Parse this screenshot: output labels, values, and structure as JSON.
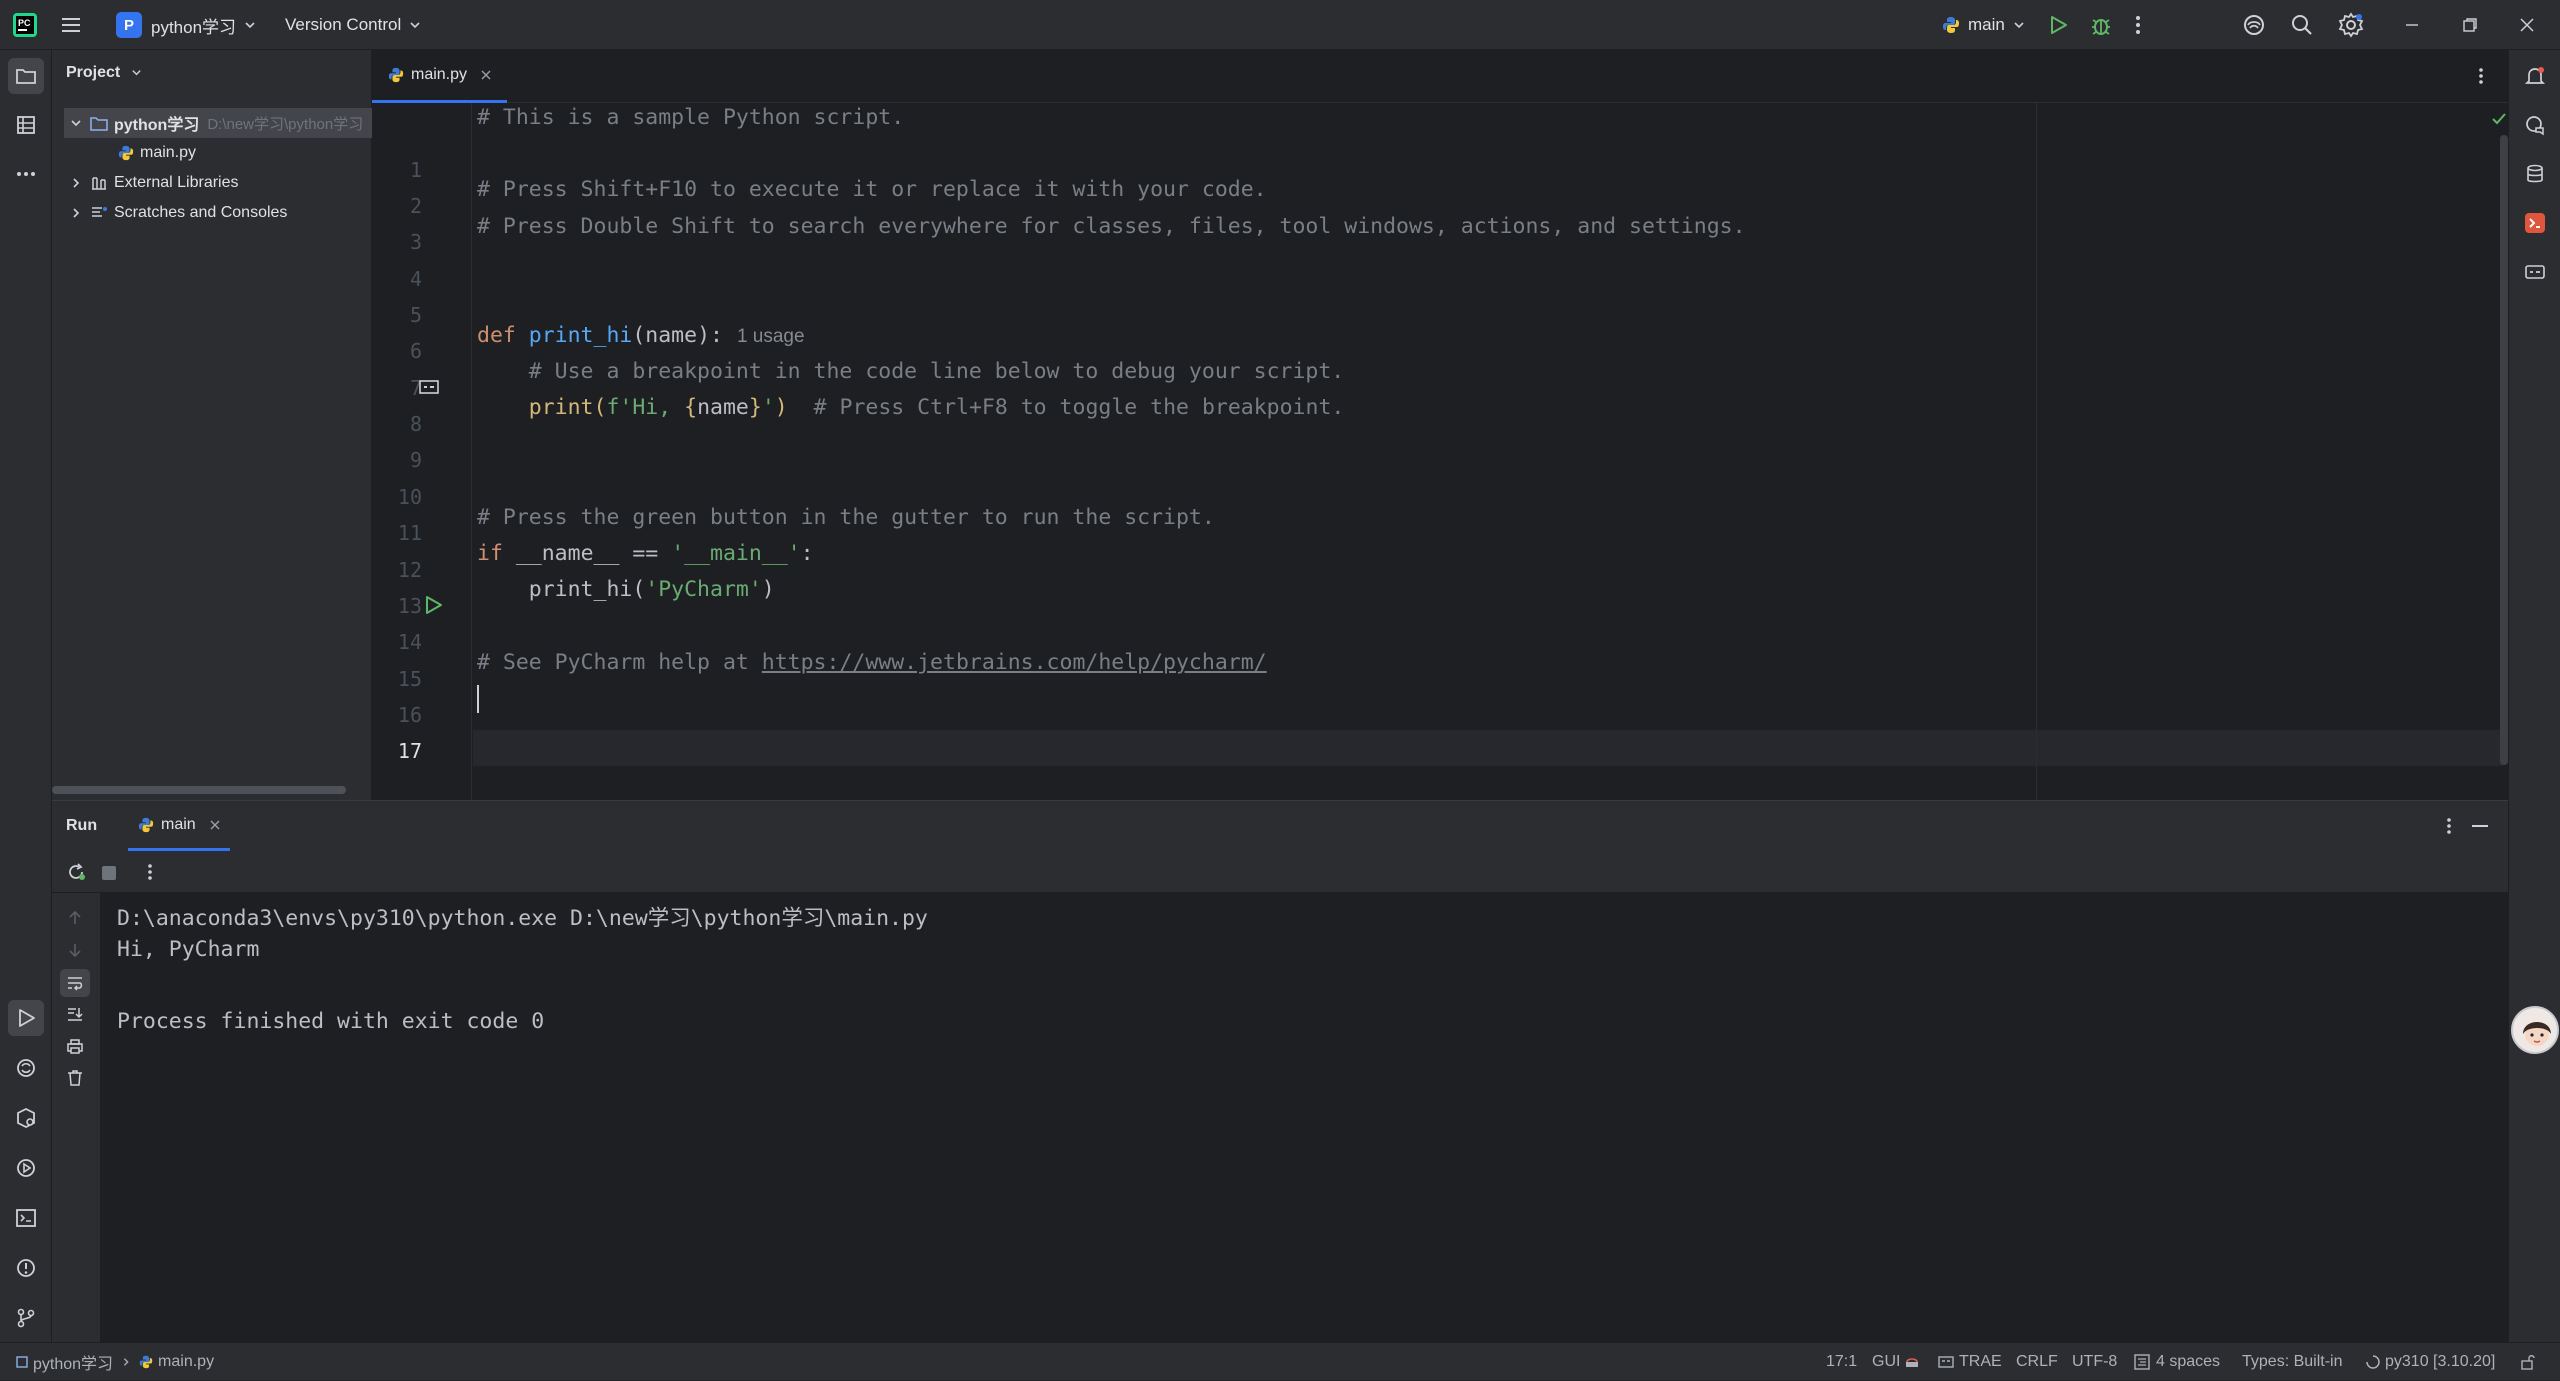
{
  "titlebar": {
    "project_initial": "P",
    "project_name": "python学习",
    "vcs": "Version Control",
    "run_config": "main"
  },
  "project_panel": {
    "title": "Project",
    "root_name": "python学习",
    "root_path": "D:\\new学习\\python学习",
    "file": "main.py",
    "external": "External Libraries",
    "scratches": "Scratches and Consoles"
  },
  "editor": {
    "tab": "main.py",
    "lines": {
      "n1": "1",
      "n2": "2",
      "n3": "3",
      "n4": "4",
      "n5": "5",
      "n6": "6",
      "n7": "7",
      "n8": "8",
      "n9": "9",
      "n10": "10",
      "n11": "11",
      "n12": "12",
      "n13": "13",
      "n14": "14",
      "n15": "15",
      "n16": "16",
      "n17": "17"
    },
    "code": {
      "l1": "# This is a sample Python script.",
      "l3": "# Press Shift+F10 to execute it or replace it with your code.",
      "l4": "# Press Double Shift to search everywhere for classes, files, tool windows, actions, and settings.",
      "l7_kw": "def ",
      "l7_fn": "print_hi",
      "l7_rest": "(name):",
      "l7_hint": "1 usage",
      "l8": "    # Use a breakpoint in the code line below to debug your script.",
      "l9_indent": "    ",
      "l9_print": "print",
      "l9_open": "(",
      "l9_str1": "f'Hi, ",
      "l9_brace1": "{",
      "l9_name": "name",
      "l9_brace2": "}",
      "l9_str2": "'",
      "l9_close": ")",
      "l9_comment": "  # Press Ctrl+F8 to toggle the breakpoint.",
      "l12": "# Press the green button in the gutter to run the script.",
      "l13_kw": "if ",
      "l13_rest": "__name__ == ",
      "l13_str": "'__main__'",
      "l13_colon": ":",
      "l14_indent": "    ",
      "l14_fn": "print_hi(",
      "l14_str": "'PyCharm'",
      "l14_close": ")",
      "l16_comment": "# See PyCharm help at ",
      "l16_link": "https://www.jetbrains.com/help/pycharm/"
    }
  },
  "run": {
    "title": "Run",
    "tab": "main",
    "output": {
      "cmd": "D:\\anaconda3\\envs\\py310\\python.exe D:\\new学习\\python学习\\main.py",
      "hi": "Hi, PyCharm",
      "finished": "Process finished with exit code 0"
    }
  },
  "statusbar": {
    "project": "python学习",
    "file": "main.py",
    "position": "17:1",
    "gui": "GUI",
    "trae": "TRAE",
    "line_sep": "CRLF",
    "encoding": "UTF-8",
    "indent": "4 spaces",
    "types": "Types: Built-in",
    "interpreter": "py310 [3.10.20]"
  },
  "colors": {
    "accent": "#3574f0",
    "run_green": "#5fb865",
    "keyword": "#cf8e6d",
    "function": "#56a8f5",
    "string": "#6aab73",
    "comment": "#7a7e85"
  }
}
